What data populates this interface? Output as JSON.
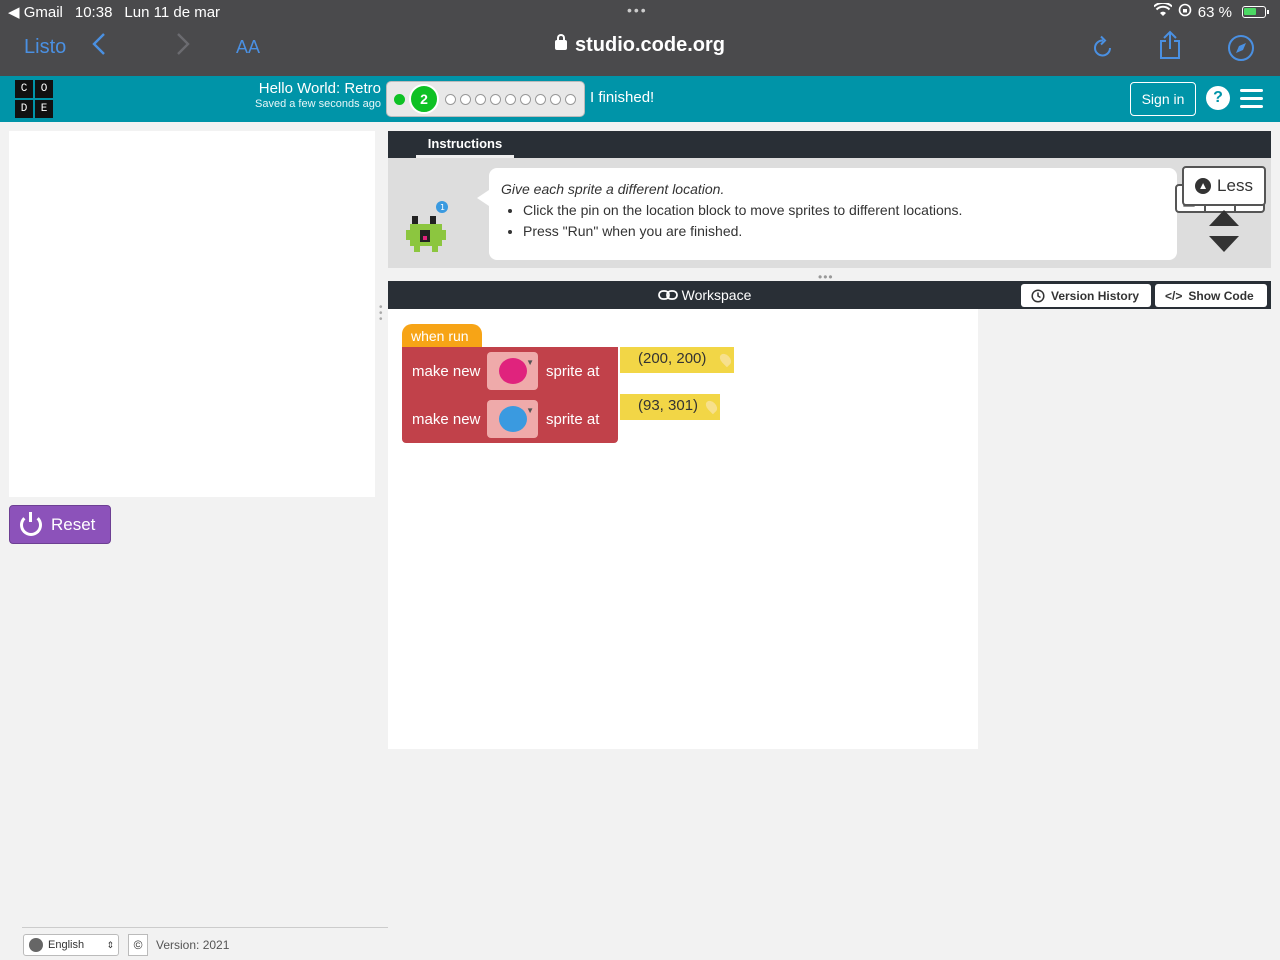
{
  "status_bar": {
    "back_app": "◀ Gmail",
    "time": "10:38",
    "date": "Lun 11 de mar",
    "battery": "63 %"
  },
  "browser": {
    "done_label": "Listo",
    "text_size": "AA",
    "url": "studio.code.org"
  },
  "header": {
    "logo_letters": [
      "C",
      "O",
      "D",
      "E"
    ],
    "level_title": "Hello World: Retro",
    "saved_status": "Saved a few seconds ago",
    "current_level": "2",
    "finished_label": "I finished!",
    "signin_label": "Sign in",
    "help_label": "?"
  },
  "left": {
    "reset_label": "Reset"
  },
  "instructions": {
    "tab_label": "Instructions",
    "lead": "Give each sprite a different location.",
    "items": [
      "Click the pin on the location block to move sprites to different locations.",
      "Press \"Run\" when you are finished."
    ],
    "less_label": "Less",
    "badge": "1"
  },
  "workspace": {
    "title": "Workspace",
    "version_history_label": "Version History",
    "show_code_label": "Show Code",
    "hat_block": "when run",
    "blocks": [
      {
        "left_label": "make new",
        "right_label": "sprite at",
        "location": "(200, 200)",
        "sprite_color": "#e0237d"
      },
      {
        "left_label": "make new",
        "right_label": "sprite at",
        "location": "(93, 301)",
        "sprite_color": "#3a9ae0"
      }
    ]
  },
  "footer": {
    "language": "English",
    "copyright": "©",
    "version": "Version: 2021"
  },
  "colors": {
    "header_teal": "#0094a8",
    "reset_purple": "#8c52ba",
    "block_red": "#c1414a",
    "block_orange": "#f7a416",
    "block_yellow": "#f2d646",
    "progress_green": "#0ec124"
  }
}
